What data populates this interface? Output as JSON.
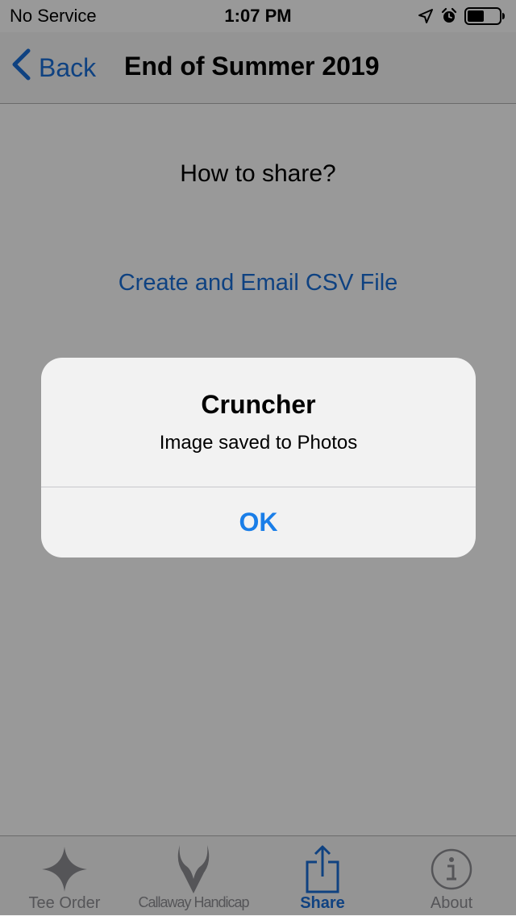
{
  "status_bar": {
    "carrier": "No Service",
    "time": "1:07 PM",
    "icons": [
      "location-arrow-icon",
      "alarm-icon",
      "battery-icon"
    ]
  },
  "nav": {
    "back_label": "Back",
    "title": "End of Summer 2019"
  },
  "content": {
    "prompt": "How to share?",
    "csv_link": "Create and Email CSV File"
  },
  "alert": {
    "title": "Cruncher",
    "message": "Image saved to Photos",
    "ok_label": "OK"
  },
  "tabs": [
    {
      "label": "Tee Order",
      "icon": "four-point-star-icon",
      "active": false
    },
    {
      "label": "Callaway Handicap",
      "icon": "horned-shield-icon",
      "active": false
    },
    {
      "label": "Share",
      "icon": "share-icon",
      "active": true
    },
    {
      "label": "About",
      "icon": "info-circle-icon",
      "active": false
    }
  ],
  "colors": {
    "accent": "#1a6ed8",
    "alert_button": "#1a7ee8",
    "inactive_tab": "#8e8e93",
    "bar_background": "#f7f7f7",
    "alert_background": "#f2f2f2"
  }
}
